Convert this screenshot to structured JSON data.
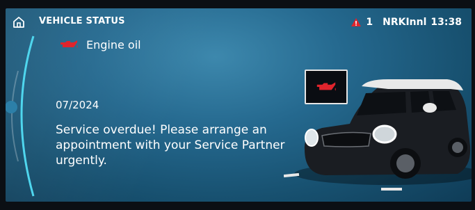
{
  "header": {
    "title": "VEHICLE STATUS",
    "warning_count": "1",
    "station": "NRKInnl",
    "time": "13:38"
  },
  "item": {
    "icon": "engine-oil-icon",
    "label": "Engine oil"
  },
  "detail": {
    "date": "07/2024",
    "message": "Service overdue! Please arrange an appointment with your Service Partner urgently."
  },
  "colors": {
    "warning_red": "#e0242c",
    "accent_cyan": "#4fd6ee"
  }
}
